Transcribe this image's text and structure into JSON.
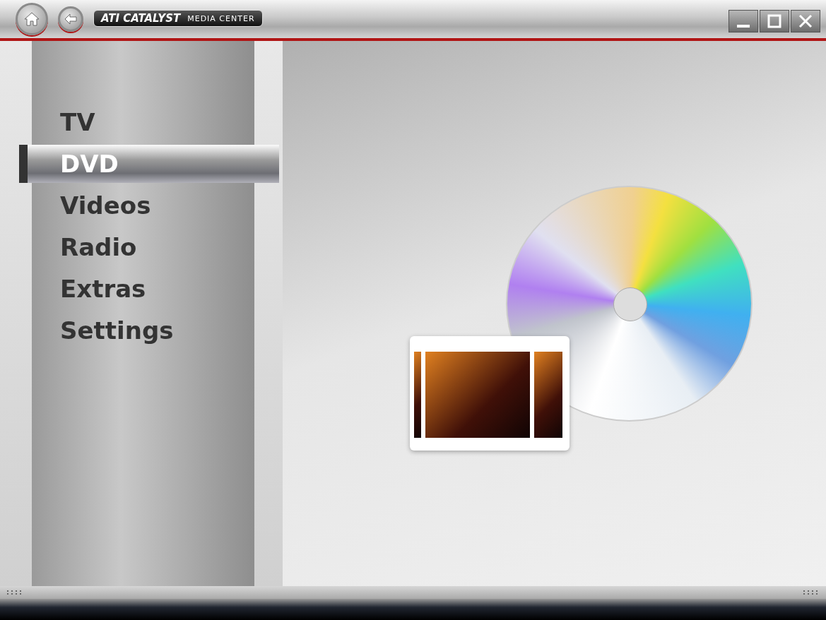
{
  "window": {
    "logo_brand": "ATI CATALYST",
    "logo_product": "MEDIA CENTER"
  },
  "menu": [
    {
      "label": "TV",
      "selected": false
    },
    {
      "label": "DVD",
      "selected": true
    },
    {
      "label": "Videos",
      "selected": false
    },
    {
      "label": "Radio",
      "selected": false
    },
    {
      "label": "Extras",
      "selected": false
    },
    {
      "label": "Settings",
      "selected": false
    }
  ]
}
